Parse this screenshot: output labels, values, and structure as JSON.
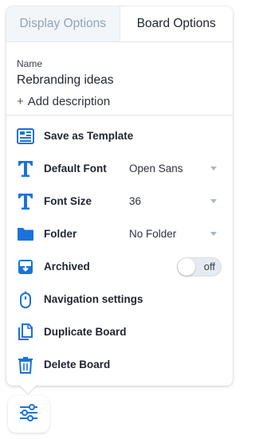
{
  "tabs": {
    "display_label": "Display Options",
    "board_label": "Board Options",
    "active": "board"
  },
  "board": {
    "name_label": "Name",
    "name_value": "Rebranding ideas",
    "add_description": "Add description"
  },
  "options": {
    "save_template": {
      "label": "Save as Template",
      "icon": "template-icon"
    },
    "default_font": {
      "label": "Default Font",
      "value": "Open Sans",
      "icon": "font-icon"
    },
    "font_size": {
      "label": "Font Size",
      "value": "36",
      "icon": "font-size-icon"
    },
    "folder": {
      "label": "Folder",
      "value": "No Folder",
      "icon": "folder-icon"
    },
    "archived": {
      "label": "Archived",
      "toggle_text": "off",
      "state": false,
      "icon": "archive-icon"
    },
    "navigation": {
      "label": "Navigation settings",
      "icon": "mouse-icon"
    },
    "duplicate": {
      "label": "Duplicate Board",
      "icon": "duplicate-icon"
    },
    "delete": {
      "label": "Delete Board",
      "icon": "trash-icon"
    }
  },
  "colors": {
    "accent": "#1a73d9",
    "text": "#1f2430",
    "inactive_tab_text": "#8fa2bd",
    "inactive_tab_bg": "#f3f6f9",
    "caret": "#a9b6c8"
  },
  "settings_button": {
    "icon": "sliders-icon"
  }
}
